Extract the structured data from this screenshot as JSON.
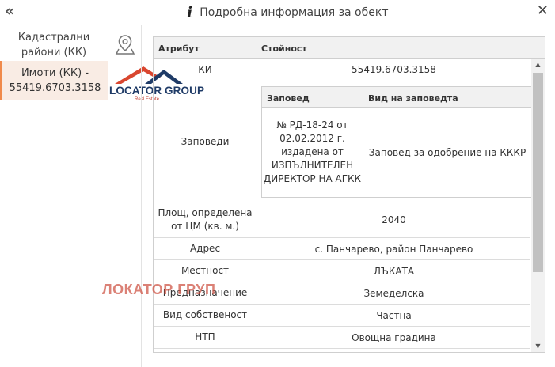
{
  "window": {
    "title": "Подробна информация за обект",
    "collapse_icon": "double-chevron-left-icon",
    "close_icon": "close-icon",
    "info_icon": "info-icon"
  },
  "sidebar": {
    "items": [
      {
        "label": "Кадастрални\nрайони (КК)",
        "active": false
      },
      {
        "label": "Имоти (КК) -\n55419.6703.3158",
        "active": true
      }
    ],
    "active_accent": "#f08a4b",
    "active_bg": "#f9ece4"
  },
  "logo": {
    "name": "LOCATOR GROUP",
    "subtitle": "Real Estate",
    "colors": {
      "red": "#d9462f",
      "navy": "#1f3b67"
    }
  },
  "table": {
    "headers": {
      "attribute": "Атрибут",
      "value": "Стойност"
    },
    "rows": [
      {
        "attribute": "КИ",
        "value": "55419.6703.3158"
      },
      {
        "attribute": "Заповеди",
        "value": ""
      },
      {
        "attribute": "Площ, определена от ЦМ (кв. м.)",
        "value": "2040"
      },
      {
        "attribute": "Адрес",
        "value": "с. Панчарево, район Панчарево"
      },
      {
        "attribute": "Местност",
        "value": "ЛЪКАТА"
      },
      {
        "attribute": "Предназначение",
        "value": "Земеделска"
      },
      {
        "attribute": "Вид собственост",
        "value": "Частна"
      },
      {
        "attribute": "НТП",
        "value": "Овощна градина"
      }
    ],
    "orders_table": {
      "headers": {
        "order": "Заповед",
        "order_type": "Вид на заповедта"
      },
      "rows": [
        {
          "order": "№ РД-18-24 от 02.02.2012 г. издадена от ИЗПЪЛНИТЕЛЕН ДИРЕКТОР НА АГКК",
          "order_type": "Заповед за одобрение на КККР"
        }
      ]
    }
  },
  "watermark": "ЛОКАТОР ГРУП"
}
